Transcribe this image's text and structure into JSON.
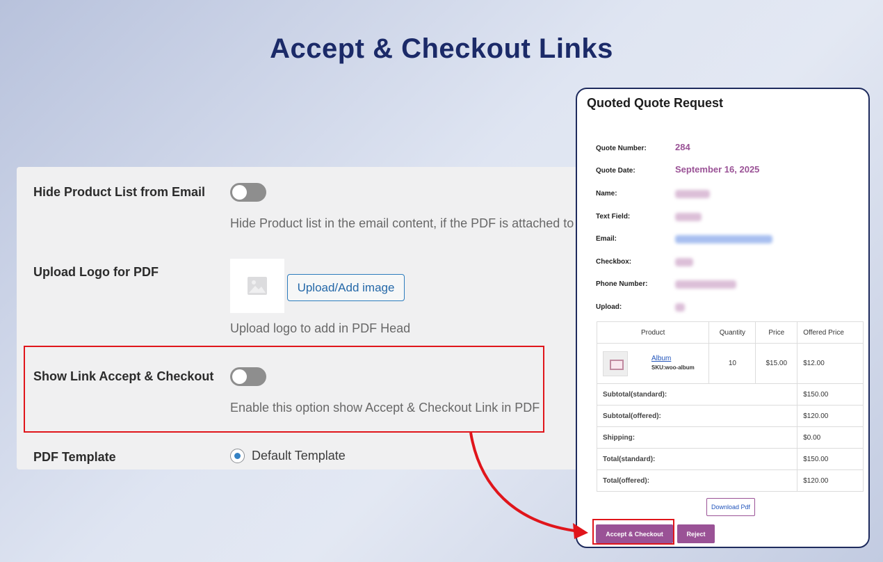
{
  "page": {
    "title": "Accept & Checkout Links"
  },
  "settings": {
    "hide_product_list": {
      "label": "Hide Product List from Email",
      "description": "Hide Product list in the email content, if the PDF is attached to"
    },
    "upload_logo": {
      "label": "Upload Logo for PDF",
      "button": "Upload/Add image",
      "description": "Upload logo to add in PDF Head"
    },
    "show_link": {
      "label": "Show Link Accept & Checkout",
      "description": "Enable this option show Accept & Checkout Link in PDF"
    },
    "pdf_template": {
      "label": "PDF Template",
      "option": "Default Template"
    }
  },
  "quote": {
    "title": "Quoted Quote Request",
    "fields": {
      "quote_number_label": "Quote Number:",
      "quote_number_value": "284",
      "quote_date_label": "Quote Date:",
      "quote_date_value": "September 16, 2025",
      "name_label": "Name:",
      "text_field_label": "Text Field:",
      "email_label": "Email:",
      "checkbox_label": "Checkbox:",
      "phone_label": "Phone Number:",
      "upload_label": "Upload:"
    },
    "table": {
      "headers": [
        "Product",
        "Quantity",
        "Price",
        "Offered Price"
      ],
      "item": {
        "name": "Album",
        "sku": "SKU:woo-album",
        "quantity": "10",
        "price": "$15.00",
        "offered_price": "$12.00"
      },
      "totals": [
        {
          "label": "Subtotal(standard):",
          "value": "$150.00"
        },
        {
          "label": "Subtotal(offered):",
          "value": "$120.00"
        },
        {
          "label": "Shipping:",
          "value": "$0.00"
        },
        {
          "label": "Total(standard):",
          "value": "$150.00"
        },
        {
          "label": "Total(offered):",
          "value": "$120.00"
        }
      ]
    },
    "download_button": "Download Pdf",
    "accept_button": "Accept & Checkout",
    "reject_button": "Reject"
  },
  "colors": {
    "title": "#1b2a68",
    "accent": "#9a5296",
    "highlight": "#e0151b",
    "link": "#2255bb"
  }
}
